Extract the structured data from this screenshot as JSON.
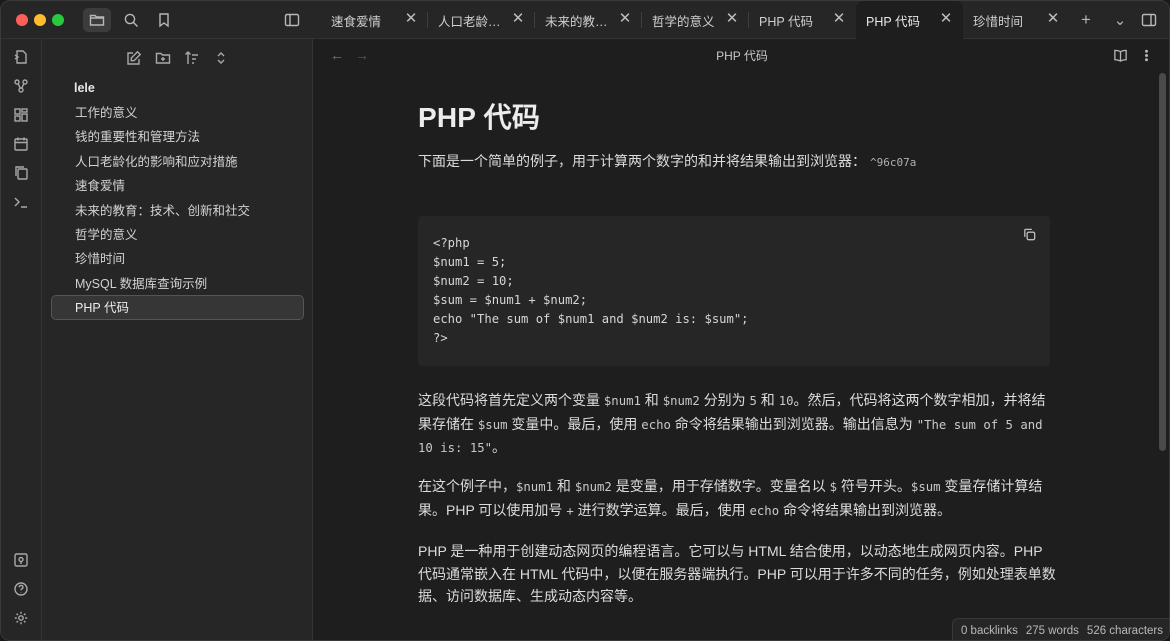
{
  "tabs": [
    {
      "label": "速食爱情",
      "active": false
    },
    {
      "label": "人口老龄化...",
      "active": false
    },
    {
      "label": "未来的教育...",
      "active": false
    },
    {
      "label": "哲学的意义",
      "active": false
    },
    {
      "label": "PHP 代码",
      "active": false
    },
    {
      "label": "PHP 代码",
      "active": true
    },
    {
      "label": "珍惜时间",
      "active": false
    }
  ],
  "tab_close_glyph": "✕",
  "tab_new_glyph": "+",
  "tab_list_glyph": "⌄",
  "sidebar": {
    "vault_name": "lele",
    "files": [
      "工作的意义",
      "钱的重要性和管理方法",
      "人口老龄化的影响和应对措施",
      "速食爱情",
      "未来的教育：技术、创新和社交",
      "哲学的意义",
      "珍惜时间",
      "MySQL 数据库查询示例",
      "PHP 代码"
    ],
    "active_file": "PHP 代码"
  },
  "view": {
    "title": "PHP 代码",
    "back_glyph": "←",
    "forward_glyph": "→"
  },
  "note": {
    "heading": "PHP 代码",
    "intro": "下面是一个简单的例子，用于计算两个数字的和并将结果输出到浏览器：",
    "block_ref": "^96c07a",
    "code": "<?php\n$num1 = 5;\n$num2 = 10;\n$sum = $num1 + $num2;\necho \"The sum of $num1 and $num2 is: $sum\";\n?>",
    "p1": {
      "t1": "这段代码将首先定义两个变量 ",
      "c1": "$num1",
      "t2": " 和 ",
      "c2": "$num2",
      "t3": " 分别为 ",
      "c3": "5",
      "t4": " 和 ",
      "c4": "10",
      "t5": "。然后，代码将这两个数字相加，并将结果存储在 ",
      "c5": "$sum",
      "t6": " 变量中。最后，使用 ",
      "c6": "echo",
      "t7": " 命令将结果输出到浏览器。输出信息为 ",
      "c7": "\"The sum of 5 and 10 is: 15\"",
      "t8": "。"
    },
    "p2": {
      "t1": "在这个例子中，",
      "c1": "$num1",
      "t2": " 和 ",
      "c2": "$num2",
      "t3": " 是变量，用于存储数字。变量名以 ",
      "c3": "$",
      "t4": " 符号开头。",
      "c4": "$sum",
      "t5": " 变量存储计算结果。PHP 可以使用加号 ",
      "c5": "+",
      "t6": " 进行数学运算。最后，使用 ",
      "c6": "echo",
      "t7": " 命令将结果输出到浏览器。"
    },
    "p3": "PHP 是一种用于创建动态网页的编程语言。它可以与 HTML 结合使用，以动态地生成网页内容。PHP 代码通常嵌入在 HTML 代码中，以便在服务器端执行。PHP 可以用于许多不同的任务，例如处理表单数据、访问数据库、生成动态内容等。"
  },
  "status": {
    "backlinks": "0 backlinks",
    "words": "275 words",
    "characters": "526 characters"
  },
  "colors": {
    "background": "#1e1e1e",
    "sidebar": "#262626",
    "accent_red": "#ff5f57",
    "accent_yellow": "#febc2e",
    "accent_green": "#28c840"
  }
}
